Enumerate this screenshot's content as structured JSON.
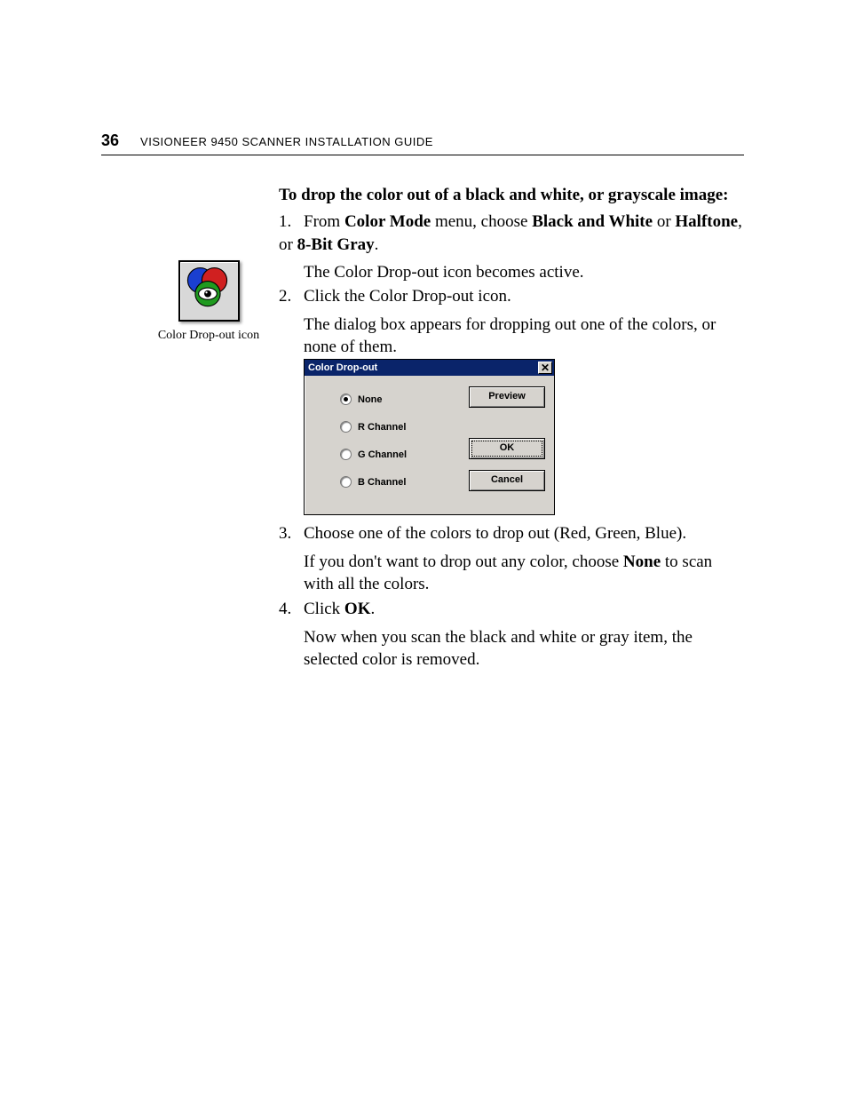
{
  "header": {
    "page_number": "36",
    "title_smallcaps": "VISIONEER 9450 SCANNER INSTALLATION GUIDE"
  },
  "heading": "To drop the color out of a black and white, or grayscale image:",
  "steps": {
    "s1": {
      "num": "1.",
      "pre": "From ",
      "b1": "Color Mode",
      "mid1": " menu, choose ",
      "b2": "Black and White",
      "mid2": " or ",
      "b3": "Halftone",
      "mid3": ", or ",
      "b4": "8-Bit Gray",
      "post": ".",
      "para": "The Color Drop-out icon becomes active."
    },
    "s2": {
      "num": "2.",
      "text": "Click the Color Drop-out icon.",
      "para": "The dialog box appears for dropping out one of the colors, or none of them."
    },
    "s3": {
      "num": "3.",
      "text": "Choose one of the colors to drop out (Red, Green, Blue).",
      "para_pre": "If you don't want to drop out any color, choose ",
      "para_b": "None",
      "para_post": " to scan with all the colors."
    },
    "s4": {
      "num": "4.",
      "pre": "Click ",
      "b1": "OK",
      "post": ".",
      "para": "Now when you scan the black and white or gray item, the selected color is removed."
    }
  },
  "aside": {
    "icon_name": "color-drop-out-icon",
    "caption": "Color Drop-out icon"
  },
  "dialog": {
    "title": "Color Drop-out",
    "close_glyph": "✕",
    "options": {
      "none": "None",
      "r": "R Channel",
      "g": "G Channel",
      "b": "B Channel"
    },
    "buttons": {
      "preview": "Preview",
      "ok": "OK",
      "cancel": "Cancel"
    }
  }
}
